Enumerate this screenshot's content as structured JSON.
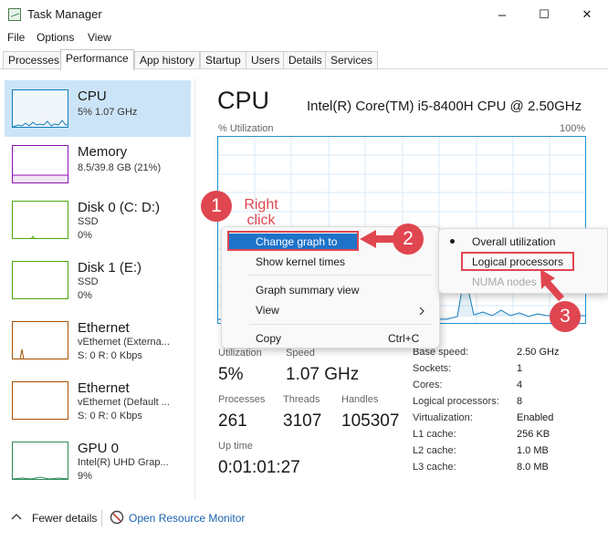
{
  "window": {
    "title": "Task Manager",
    "minimize": "–",
    "maximize": "☐",
    "close": "✕"
  },
  "menu": [
    "File",
    "Options",
    "View"
  ],
  "tabs": [
    "Processes",
    "Performance",
    "App history",
    "Startup",
    "Users",
    "Details",
    "Services"
  ],
  "sidebar": [
    {
      "title": "CPU",
      "lines": [
        "5%  1.07 GHz"
      ],
      "color": "#117dbb"
    },
    {
      "title": "Memory",
      "lines": [
        "8.5/39.8 GB (21%)"
      ],
      "color": "#8b12ae"
    },
    {
      "title": "Disk 0 (C: D:)",
      "lines": [
        "SSD",
        "0%"
      ],
      "color": "#4da60c"
    },
    {
      "title": "Disk 1 (E:)",
      "lines": [
        "SSD",
        "0%"
      ],
      "color": "#4da60c"
    },
    {
      "title": "Ethernet",
      "lines": [
        "vEthernet (Externa...",
        "S: 0  R: 0 Kbps"
      ],
      "color": "#a74f01"
    },
    {
      "title": "Ethernet",
      "lines": [
        "vEthernet (Default ...",
        "S: 0  R: 0 Kbps"
      ],
      "color": "#a74f01"
    },
    {
      "title": "GPU 0",
      "lines": [
        "Intel(R) UHD Grap...",
        "9%"
      ],
      "color": "#2e8b57"
    }
  ],
  "main": {
    "title": "CPU",
    "model": "Intel(R) Core(TM) i5-8400H CPU @ 2.50GHz",
    "graph_label": "% Utilization",
    "graph_max": "100%",
    "stats": {
      "utilization_label": "Utilization",
      "utilization": "5%",
      "speed_label": "Speed",
      "speed": "1.07 GHz",
      "processes_label": "Processes",
      "processes": "261",
      "threads_label": "Threads",
      "threads": "3107",
      "handles_label": "Handles",
      "handles": "105307",
      "uptime_label": "Up time",
      "uptime": "0:01:01:27"
    },
    "specs": [
      {
        "label": "Base speed:",
        "value": "2.50 GHz"
      },
      {
        "label": "Sockets:",
        "value": "1"
      },
      {
        "label": "Cores:",
        "value": "4"
      },
      {
        "label": "Logical processors:",
        "value": "8"
      },
      {
        "label": "Virtualization:",
        "value": "Enabled"
      },
      {
        "label": "L1 cache:",
        "value": "256 KB"
      },
      {
        "label": "L2 cache:",
        "value": "1.0 MB"
      },
      {
        "label": "L3 cache:",
        "value": "8.0 MB"
      }
    ]
  },
  "context_menu": {
    "change_graph": "Change graph to",
    "kernel_times": "Show kernel times",
    "summary_view": "Graph summary view",
    "view": "View",
    "copy": "Copy",
    "copy_shortcut": "Ctrl+C"
  },
  "submenu": {
    "overall": "Overall utilization",
    "logical": "Logical processors",
    "numa": "NUMA nodes"
  },
  "annotations": {
    "step1": "1",
    "step1_text": "Right click",
    "step2": "2",
    "step3": "3"
  },
  "footer": {
    "fewer_details": "Fewer details",
    "resource_monitor": "Open Resource Monitor"
  }
}
